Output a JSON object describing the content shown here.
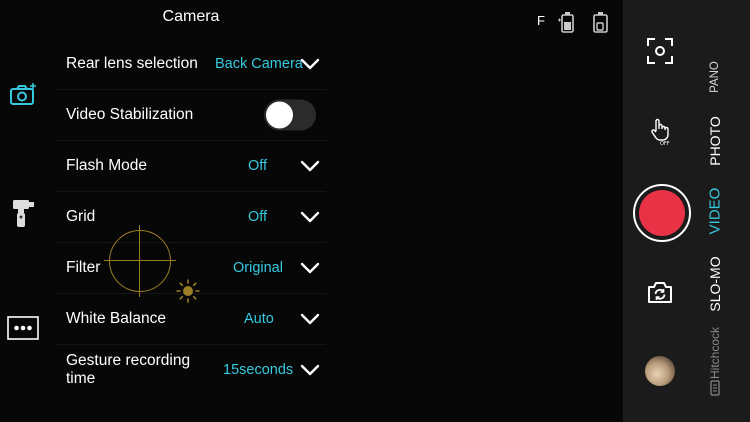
{
  "settings": {
    "title": "Camera",
    "rows": [
      {
        "label": "Rear lens selection",
        "value": "Back Camera"
      },
      {
        "label": "Video Stabilization",
        "value": ""
      },
      {
        "label": "Flash Mode",
        "value": "Off"
      },
      {
        "label": "Grid",
        "value": "Off"
      },
      {
        "label": "Filter",
        "value": "Original"
      },
      {
        "label": "White Balance",
        "value": "Auto"
      },
      {
        "label": "Gesture recording time",
        "value": "15seconds"
      }
    ],
    "stabilization_enabled": false
  },
  "status": {
    "flash": "F"
  },
  "left_toolbar": {
    "items": [
      "camera-add-icon",
      "gimbal-icon",
      "more-icon"
    ]
  },
  "right_panel": {
    "modes": [
      "PANO",
      "PHOTO",
      "VIDEO",
      "SLO-MO",
      "Hitchcock"
    ],
    "active_mode": "VIDEO",
    "record_color": "#ea3247",
    "accent_color": "#36c8de"
  }
}
